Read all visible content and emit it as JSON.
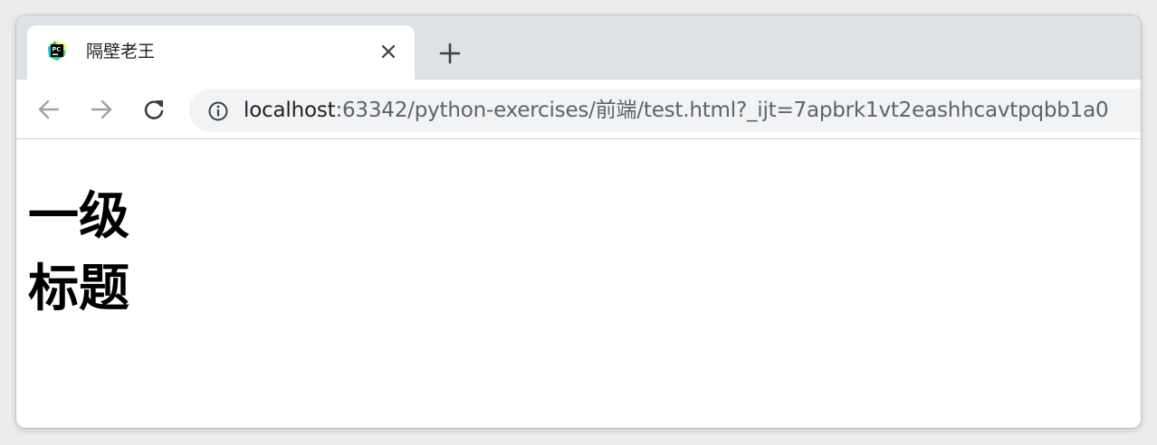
{
  "tab": {
    "title": "隔壁老王",
    "favicon": "pycharm-icon"
  },
  "toolbar": {
    "url_host": "localhost",
    "url_rest": ":63342/python-exercises/前端/test.html?_ijt=7apbrk1vt2eashhcavtpqbb1a0"
  },
  "page": {
    "heading": "一级标题"
  },
  "colors": {
    "tabstrip": "#dee1e6",
    "omnibox": "#f1f3f4",
    "url_host": "#202124",
    "url_rest": "#5f6368",
    "icon": "#5f6368",
    "icon_disabled": "#a0a4a8"
  }
}
